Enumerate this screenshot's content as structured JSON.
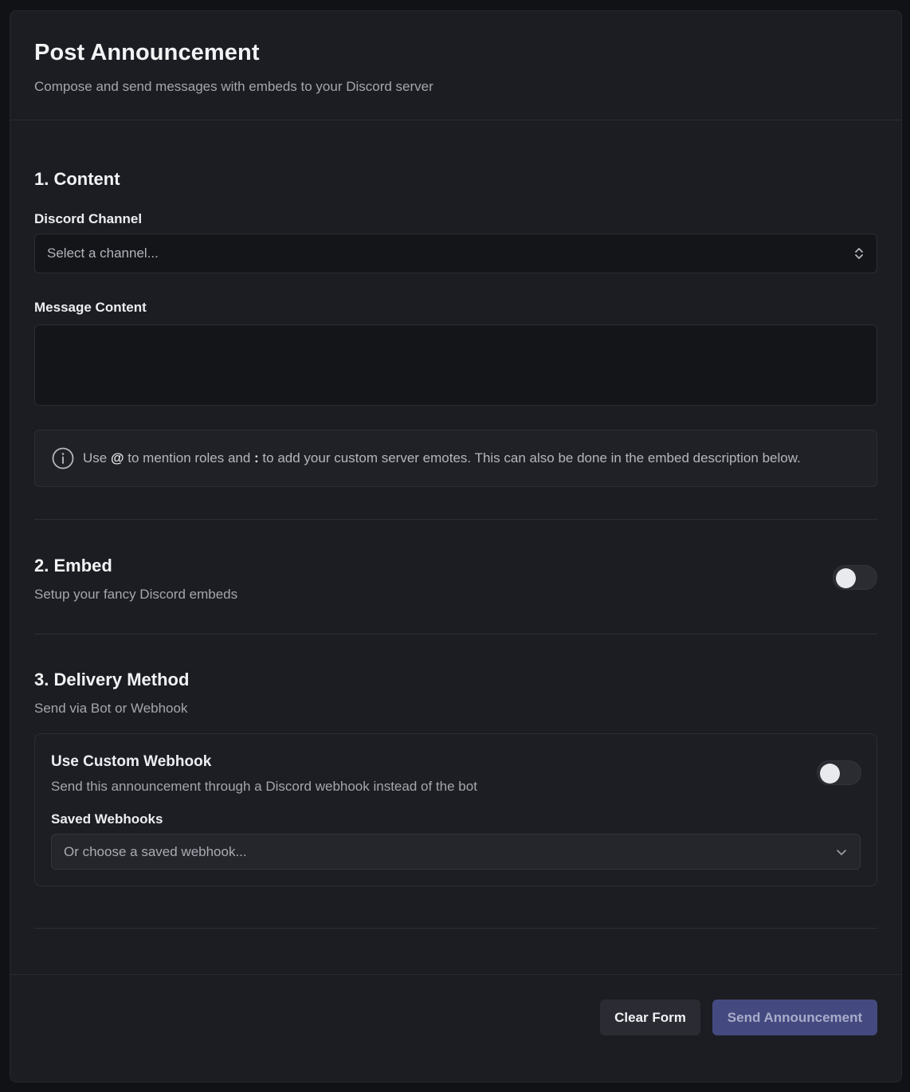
{
  "header": {
    "title": "Post Announcement",
    "subtitle": "Compose and send messages with embeds to your Discord server"
  },
  "content": {
    "heading": "1. Content",
    "channel_label": "Discord Channel",
    "channel_placeholder": "Select a channel...",
    "message_label": "Message Content",
    "message_value": "",
    "info": {
      "part1": "Use ",
      "mention_symbol": "@",
      "part2": " to mention roles and ",
      "emote_symbol": ":",
      "part3": " to add your custom server emotes. This can also be done in the embed description below."
    }
  },
  "embed": {
    "heading": "2. Embed",
    "subtitle": "Setup your fancy Discord embeds",
    "enabled": false
  },
  "delivery": {
    "heading": "3. Delivery Method",
    "subtitle": "Send via Bot or Webhook",
    "webhook_title": "Use Custom Webhook",
    "webhook_description": "Send this announcement through a Discord webhook instead of the bot",
    "webhook_enabled": false,
    "saved_label": "Saved Webhooks",
    "saved_placeholder": "Or choose a saved webhook..."
  },
  "footer": {
    "clear_label": "Clear Form",
    "send_label": "Send Announcement"
  },
  "colors": {
    "accent": "#444a80",
    "background": "#111215",
    "card": "#1c1d22"
  }
}
